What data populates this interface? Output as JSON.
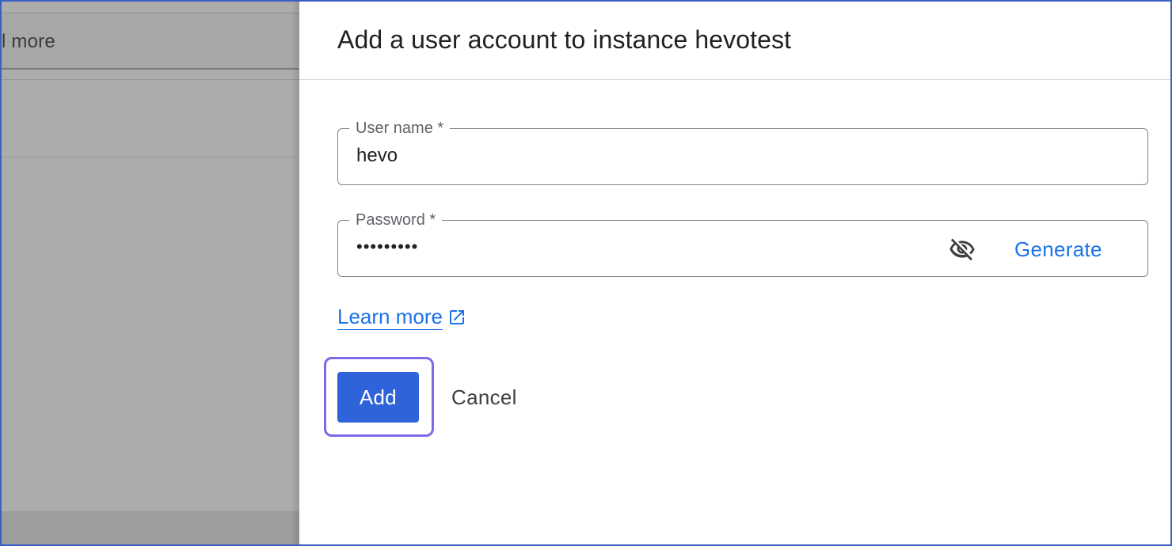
{
  "background": {
    "tab_text": "l more"
  },
  "panel": {
    "title": "Add a user account to instance hevotest"
  },
  "username": {
    "label": "User name *",
    "value": "hevo"
  },
  "password": {
    "label": "Password *",
    "masked_value": "•••••••••",
    "visibility_icon": "visibility-off-icon",
    "generate_label": "Generate"
  },
  "learn_more": {
    "label": "Learn more",
    "icon": "open-in-new-icon"
  },
  "actions": {
    "add_label": "Add",
    "cancel_label": "Cancel"
  },
  "colors": {
    "accent": "#1a73e8",
    "primary_button": "#2e63d9",
    "focus_ring": "#7c6ae8",
    "backdrop": "#acacac"
  }
}
